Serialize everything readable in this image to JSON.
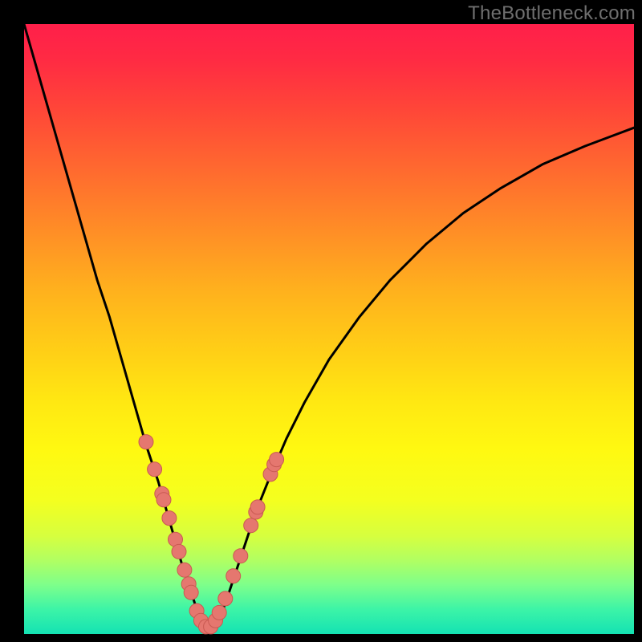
{
  "watermark": "TheBottleneck.com",
  "colors": {
    "curve_stroke": "#000000",
    "marker_fill": "#e5776f",
    "marker_stroke": "#c95a52"
  },
  "chart_data": {
    "type": "line",
    "title": "",
    "xlabel": "",
    "ylabel": "",
    "xlim": [
      0,
      100
    ],
    "ylim": [
      0,
      100
    ],
    "grid": false,
    "legend": false,
    "series": [
      {
        "name": "bottleneck-curve",
        "x": [
          0,
          2,
          4,
          6,
          8,
          10,
          12,
          14,
          16,
          18,
          20,
          22,
          24,
          26,
          27,
          28,
          29,
          30,
          31,
          32,
          33,
          34,
          36,
          38,
          40,
          43,
          46,
          50,
          55,
          60,
          66,
          72,
          78,
          85,
          92,
          100
        ],
        "y": [
          100,
          93,
          86,
          79,
          72,
          65,
          58,
          52,
          45,
          38,
          31,
          25,
          18,
          11,
          8,
          5,
          2.5,
          1,
          1,
          2.5,
          5,
          8,
          14,
          20,
          25,
          32,
          38,
          45,
          52,
          58,
          64,
          69,
          73,
          77,
          80,
          83
        ]
      }
    ],
    "markers": [
      {
        "x": 20.0,
        "y": 31.5
      },
      {
        "x": 21.4,
        "y": 27.0
      },
      {
        "x": 22.6,
        "y": 23.0
      },
      {
        "x": 22.9,
        "y": 22.0
      },
      {
        "x": 23.8,
        "y": 19.0
      },
      {
        "x": 24.8,
        "y": 15.5
      },
      {
        "x": 25.4,
        "y": 13.5
      },
      {
        "x": 26.3,
        "y": 10.5
      },
      {
        "x": 27.0,
        "y": 8.2
      },
      {
        "x": 27.4,
        "y": 6.8
      },
      {
        "x": 28.3,
        "y": 3.8
      },
      {
        "x": 29.0,
        "y": 2.2
      },
      {
        "x": 29.8,
        "y": 1.2
      },
      {
        "x": 30.6,
        "y": 1.2
      },
      {
        "x": 31.4,
        "y": 2.2
      },
      {
        "x": 32.0,
        "y": 3.5
      },
      {
        "x": 33.0,
        "y": 5.8
      },
      {
        "x": 34.3,
        "y": 9.5
      },
      {
        "x": 35.5,
        "y": 12.8
      },
      {
        "x": 37.2,
        "y": 17.8
      },
      {
        "x": 38.0,
        "y": 20.0
      },
      {
        "x": 38.3,
        "y": 20.8
      },
      {
        "x": 40.4,
        "y": 26.2
      },
      {
        "x": 41.0,
        "y": 27.8
      },
      {
        "x": 41.4,
        "y": 28.6
      }
    ],
    "marker_radius_px": 9
  }
}
